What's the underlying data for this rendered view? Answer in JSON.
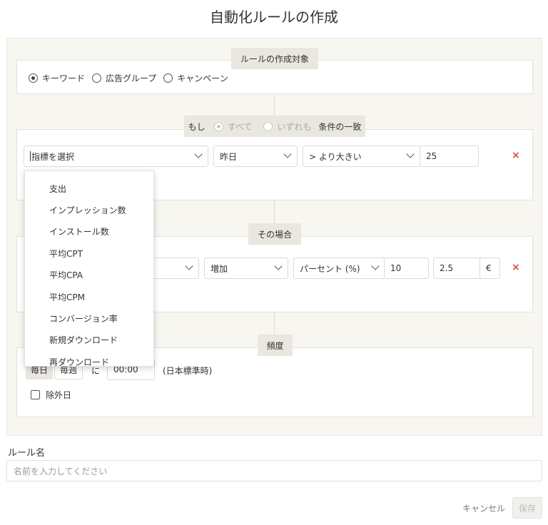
{
  "title": "自動化ルールの作成",
  "target_section": {
    "label": "ルールの作成対象",
    "options": [
      {
        "label": "キーワード",
        "checked": true
      },
      {
        "label": "広告グループ",
        "checked": false
      },
      {
        "label": "キャンペーン",
        "checked": false
      }
    ]
  },
  "condition_section": {
    "prefix": "もし",
    "option_all": "すべて",
    "option_any": "いずれも",
    "suffix": "条件の一致",
    "metric_value": "指標を選択",
    "period_value": "昨日",
    "operator_value": "> より大きい",
    "threshold_value": "25",
    "delete_symbol": "×"
  },
  "metric_dropdown": {
    "items": [
      "支出",
      "インプレッション数",
      "インストール数",
      "平均CPT",
      "平均CPA",
      "平均CPM",
      "コンバージョン率",
      "新規ダウンロード",
      "再ダウンロード"
    ]
  },
  "action_section": {
    "label": "その場合",
    "change_value": "増加",
    "unit_value": "パーセント (%)",
    "amount_value": "10",
    "limit_value": "2.5",
    "currency": "€",
    "delete_symbol": "×"
  },
  "frequency_section": {
    "label": "頻度",
    "daily": "毎日",
    "weekly": "毎週",
    "at": "に",
    "time_value": "00:00",
    "timezone": "(日本標準時)",
    "exclude_days": "除外日"
  },
  "rule_name": {
    "label": "ルール名",
    "placeholder": "名前を入力してください"
  },
  "buttons": {
    "cancel": "キャンセル",
    "save": "保存"
  },
  "colors": {
    "panel_bg": "#f7f6f1",
    "chip_bg": "#e9e7df",
    "delete_red": "#e0453a"
  }
}
